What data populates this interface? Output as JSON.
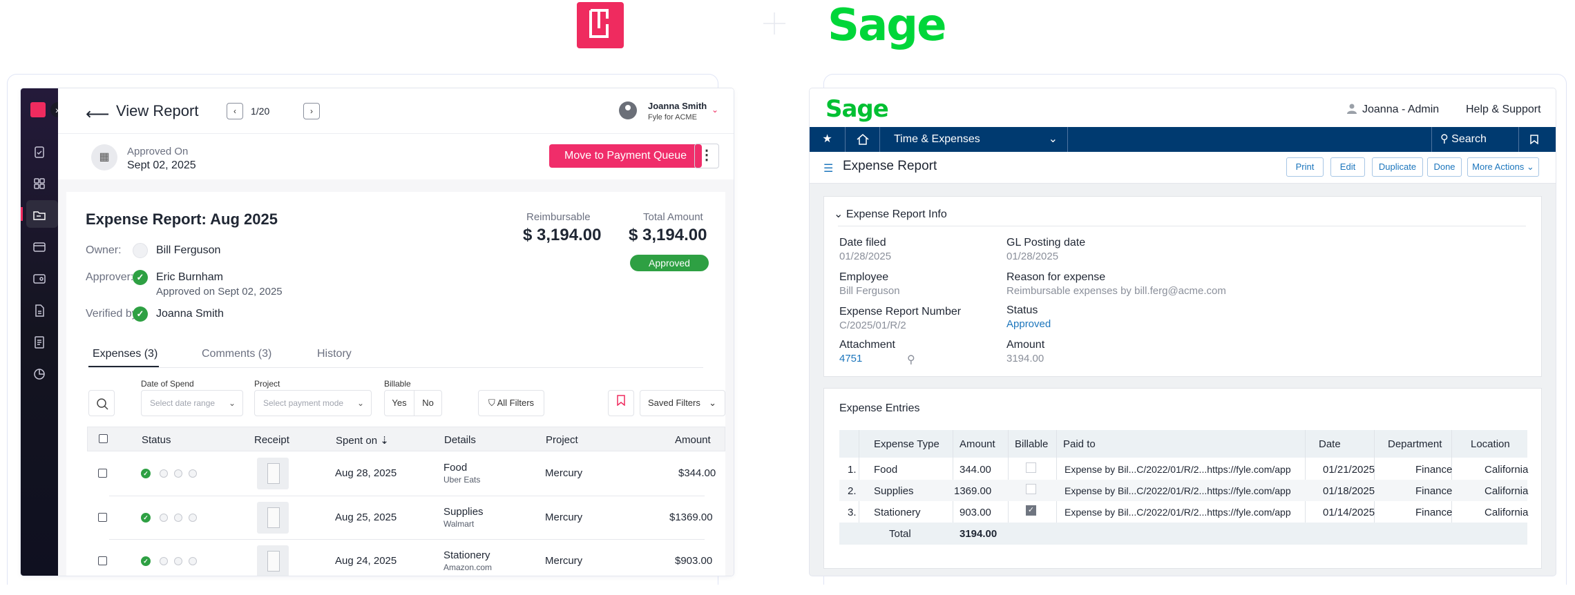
{
  "fyle": {
    "header": {
      "title": "View Report",
      "pager": "1/20",
      "user_name": "Joanna Smith",
      "user_org": "Fyle for ACME"
    },
    "approved_on_label": "Approved On",
    "approved_on_date": "Sept 02, 2025",
    "primary_action": "Move to Payment Queue",
    "report": {
      "title": "Expense Report: Aug 2025",
      "owner_label": "Owner:",
      "owner": "Bill Ferguson",
      "approver_label": "Approver:",
      "approver": "Eric Burnham",
      "approver_sub": "Approved on Sept 02, 2025",
      "verified_label": "Verified by:",
      "verifier": "Joanna Smith",
      "reimbursable_label": "Reimbursable",
      "reimbursable_value": "$ 3,194.00",
      "total_label": "Total Amount",
      "total_value": "$ 3,194.00",
      "status": "Approved"
    },
    "tabs": [
      "Expenses (3)",
      "Comments (3)",
      "History"
    ],
    "filters": {
      "date_label": "Date of Spend",
      "date_placeholder": "Select date range",
      "project_label": "Project",
      "project_placeholder": "Select payment mode",
      "billable_label": "Billable",
      "yes": "Yes",
      "no": "No",
      "all_filters": "All Filters",
      "saved_filters": "Saved Filters"
    },
    "columns": [
      "Status",
      "Receipt",
      "Spent on",
      "Details",
      "Project",
      "Amount"
    ],
    "rows": [
      {
        "spent_on": "Aug 28, 2025",
        "category": "Food",
        "merchant": "Uber Eats",
        "project": "Mercury",
        "amount": "$344.00"
      },
      {
        "spent_on": "Aug 25, 2025",
        "category": "Supplies",
        "merchant": "Walmart",
        "project": "Mercury",
        "amount": "$1369.00"
      },
      {
        "spent_on": "Aug 24, 2025",
        "category": "Stationery",
        "merchant": "Amazon.com",
        "project": "Mercury",
        "amount": "$903.00"
      }
    ],
    "colors": {
      "brand": "#ef2b5f",
      "approved": "#2ea043"
    }
  },
  "sage": {
    "logo": "Sage",
    "user": "Joanna - Admin",
    "help": "Help & Support",
    "nav": {
      "module": "Time & Expenses",
      "search": "Search"
    },
    "page_title": "Expense Report",
    "actions": [
      "Print",
      "Edit",
      "Duplicate",
      "Done",
      "More Actions"
    ],
    "info": {
      "section_title": "Expense Report Info",
      "date_filed_label": "Date filed",
      "date_filed": "01/28/2025",
      "gl_posting_label": "GL Posting date",
      "gl_posting": "01/28/2025",
      "employee_label": "Employee",
      "employee": "Bill Ferguson",
      "reason_label": "Reason for expense",
      "reason": "Reimbursable expenses by bill.ferg@acme.com",
      "number_label": "Expense Report Number",
      "number": "C/2025/01/R/2",
      "status_label": "Status",
      "status": "Approved",
      "attachment_label": "Attachment",
      "attachment": "4751",
      "amount_label": "Amount",
      "amount": "3194.00"
    },
    "entries": {
      "section_title": "Expense Entries",
      "columns": [
        "Expense Type",
        "Amount",
        "Billable",
        "Paid to",
        "Date",
        "Department",
        "Location"
      ],
      "rows": [
        {
          "n": "1.",
          "type": "Food",
          "amount": "344.00",
          "billable": false,
          "paid_to": "Expense by Bil...C/2022/01/R/2...https://fyle.com/app",
          "date": "01/21/2025",
          "department": "Finance",
          "location": "California"
        },
        {
          "n": "2.",
          "type": "Supplies",
          "amount": "1369.00",
          "billable": false,
          "paid_to": "Expense by Bil...C/2022/01/R/2...https://fyle.com/app",
          "date": "01/18/2025",
          "department": "Finance",
          "location": "California"
        },
        {
          "n": "3.",
          "type": "Stationery",
          "amount": "903.00",
          "billable": true,
          "paid_to": "Expense by Bil...C/2022/01/R/2...https://fyle.com/app",
          "date": "01/14/2025",
          "department": "Finance",
          "location": "California"
        }
      ],
      "total_label": "Total",
      "total_value": "3194.00"
    },
    "colors": {
      "brand": "#00d639",
      "nav": "#003a70",
      "link": "#1b75bc"
    }
  }
}
